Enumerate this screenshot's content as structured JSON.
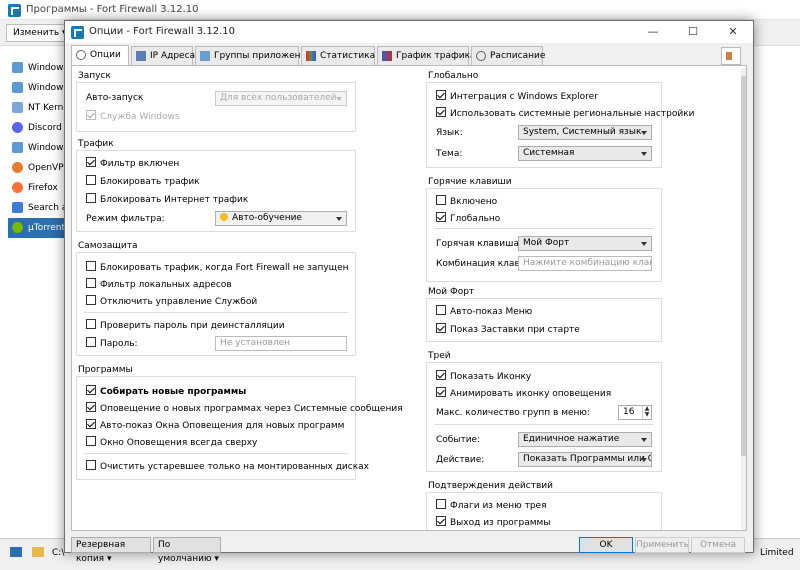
{
  "back_window": {
    "title": "Программы - Fort Firewall 3.12.10",
    "toolbar_change": "Изменить",
    "apps": [
      "Windows",
      "Windows",
      "NT Kernel",
      "Discord",
      "Windows",
      "OpenVPN",
      "Firefox",
      "Search app",
      "μTorrent"
    ],
    "taskbar_text": "C:\\",
    "taskbar_right": "Limited"
  },
  "dialog": {
    "title": "Опции - Fort Firewall 3.12.10",
    "tabs": [
      "Опции",
      "IP Адреса",
      "Группы приложений",
      "Статистика",
      "График трафика",
      "Расписание"
    ]
  },
  "launch": {
    "header": "Запуск",
    "autorun_label": "Авто-запуск",
    "autorun_value": "Для всех пользователей",
    "service_label": "Служба Windows"
  },
  "traffic": {
    "header": "Трафик",
    "filter_on": "Фильтр включен",
    "block_traffic": "Блокировать трафик",
    "block_internet": "Блокировать Интернет трафик",
    "filter_mode_label": "Режим фильтра:",
    "filter_mode_value": "Авто-обучение"
  },
  "protection": {
    "header": "Самозащита",
    "block_when_not_running": "Блокировать трафик, когда Fort Firewall не запущен",
    "filter_local": "Фильтр локальных адресов",
    "disable_service_control": "Отключить управление Службой",
    "check_password_uninstall": "Проверить пароль при деинсталляции",
    "password_label": "Пароль:",
    "password_placeholder": "Не установлен"
  },
  "programs": {
    "header": "Программы",
    "collect_new": "Собирать новые программы",
    "notify_new": "Оповещение о новых программах через Системные сообщения",
    "autoshow_alert": "Авто-показ Окна Оповещения для новых программ",
    "alert_on_top": "Окно Оповещения всегда сверху",
    "purge_mounted": "Очистить устаревшее только на монтированных дисках"
  },
  "global": {
    "header": "Глобально",
    "explorer_integration": "Интеграция с Windows Explorer",
    "use_regional": "Использовать системные региональные настройки",
    "language_label": "Язык:",
    "language_value": "System, Системный язык",
    "theme_label": "Тема:",
    "theme_value": "Системная"
  },
  "hotkeys": {
    "header": "Горячие клавиши",
    "enabled": "Включено",
    "global": "Глобально",
    "hotkey_label": "Горячая клавиша:",
    "hotkey_value": "Мой Форт",
    "combo_label": "Комбинация клавиш:",
    "combo_placeholder": "Нажмите комбинацию клавиш"
  },
  "myfort": {
    "header": "Мой Форт",
    "autoshow_menu": "Авто-показ Меню",
    "show_splash": "Показ Заставки при старте"
  },
  "tray": {
    "header": "Трей",
    "show_icon": "Показать Иконку",
    "animate_icon": "Анимировать иконку оповещения",
    "max_groups_label": "Макс. количество групп в меню:",
    "max_groups_value": "16",
    "event_label": "Событие:",
    "event_value": "Единичное нажатие",
    "action_label": "Действие:",
    "action_value": "Показать Программы или Окно"
  },
  "confirm": {
    "header": "Подтверждения действий",
    "tray_flags": "Флаги из меню трея",
    "exit_program": "Выход из программы"
  },
  "footer": {
    "backup": "Резервная копия",
    "defaults": "По умолчанию",
    "ok": "OK",
    "apply": "Применить",
    "cancel": "Отмена"
  },
  "colors": {
    "accent": "#2a6fb0",
    "dialog_bg": "#f0f0f0"
  }
}
